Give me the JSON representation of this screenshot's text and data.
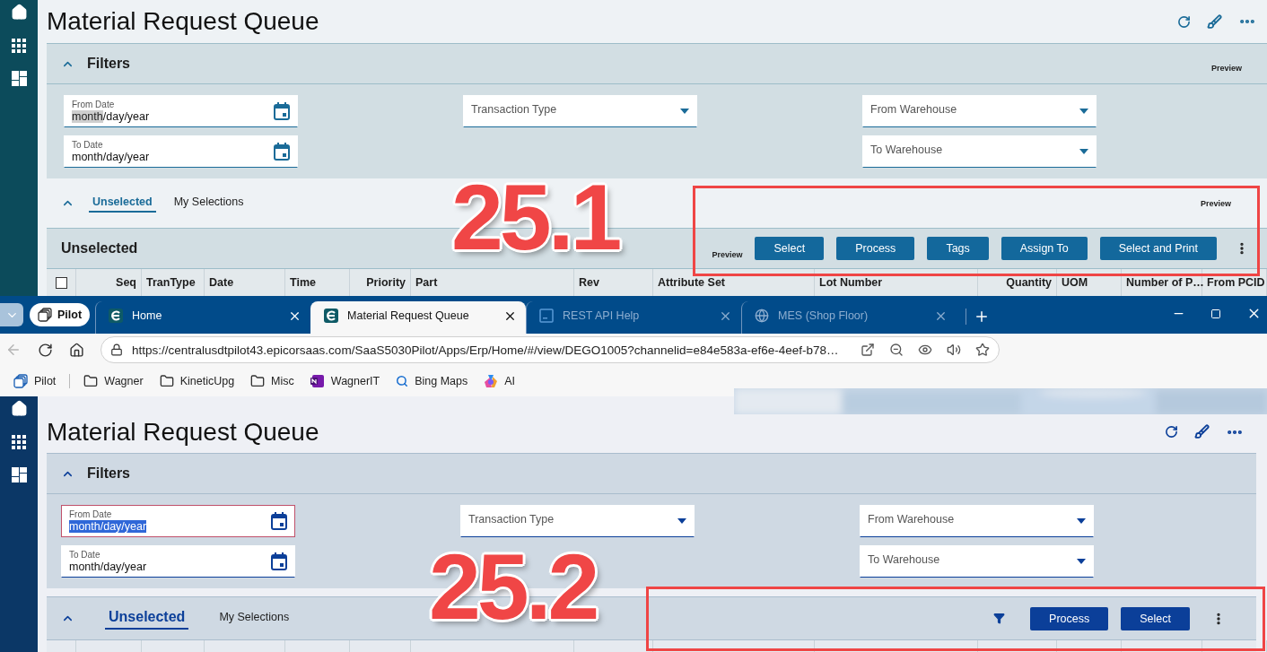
{
  "top_app": {
    "annotation": "25.1",
    "title": "Material Request Queue",
    "filters": {
      "title": "Filters",
      "expanded": true,
      "preview": "Preview",
      "columns": [
        [
          {
            "kind": "date",
            "label": "From Date",
            "focused": false,
            "value_parts": [
              {
                "text": "month",
                "highlighted": true
              },
              {
                "text": "/day/year",
                "highlighted": false
              }
            ]
          },
          {
            "kind": "date",
            "label": "To Date",
            "focused": false,
            "value_parts": [
              {
                "text": "month/day/year",
                "highlighted": false
              }
            ]
          }
        ],
        [
          {
            "kind": "dropdown",
            "label": "Transaction Type",
            "focused": false
          }
        ],
        [
          {
            "kind": "dropdown",
            "label": "From Warehouse",
            "focused": false
          },
          {
            "kind": "dropdown",
            "label": "To Warehouse",
            "focused": false
          }
        ]
      ]
    },
    "tabs_expanded": true,
    "tabs": [
      {
        "label": "Unselected",
        "selected": true
      },
      {
        "label": "My Selections",
        "selected": false
      }
    ],
    "tabs_preview": "Preview",
    "grid": {
      "title": "Unselected",
      "preview": "Preview",
      "buttons": [
        "Select",
        "Process",
        "Tags",
        "Assign To",
        "Select and Print"
      ],
      "select_all_checked": false,
      "columns": [
        {
          "label": "Seq",
          "right_aligned": true
        },
        {
          "label": "TranType",
          "right_aligned": false
        },
        {
          "label": "Date",
          "right_aligned": false
        },
        {
          "label": "Time",
          "right_aligned": false
        },
        {
          "label": "Priority",
          "right_aligned": true
        },
        {
          "label": "Part",
          "right_aligned": false
        },
        {
          "label": "Rev",
          "right_aligned": false
        },
        {
          "label": "Attribute Set",
          "right_aligned": false
        },
        {
          "label": "Lot Number",
          "right_aligned": false
        },
        {
          "label": "Quantity",
          "right_aligned": true
        },
        {
          "label": "UOM",
          "right_aligned": false
        },
        {
          "label": "Number of P…",
          "right_aligned": false
        },
        {
          "label": "From PCID",
          "right_aligned": false
        }
      ]
    }
  },
  "browser": {
    "profile": "Pilot",
    "tabs": [
      {
        "kind": "app",
        "label": "Home",
        "selected": false,
        "dimmed": false
      },
      {
        "kind": "app",
        "label": "Material Request Queue",
        "selected": true,
        "dimmed": false
      },
      {
        "kind": "docs",
        "label": "REST API Help",
        "selected": false,
        "dimmed": true
      },
      {
        "kind": "site",
        "label": "MES (Shop Floor)",
        "selected": false,
        "dimmed": true
      }
    ],
    "back_disabled": true,
    "url": "https://centralusdtpilot43.epicorsaas.com/SaaS5030Pilot/Apps/Erp/Home/#/view/DEGO1005?channelid=e84e583a-ef6e-4eef-b78…",
    "bookmarks": [
      {
        "kind": "profile",
        "label": "Pilot"
      },
      {
        "kind": "folder",
        "label": "Wagner"
      },
      {
        "kind": "folder",
        "label": "KineticUpg"
      },
      {
        "kind": "folder",
        "label": "Misc"
      },
      {
        "kind": "notebook",
        "label": "WagnerIT"
      },
      {
        "kind": "search",
        "label": "Bing Maps"
      },
      {
        "kind": "assistant",
        "label": "AI"
      }
    ]
  },
  "bottom_app": {
    "annotation": "25.2",
    "title": "Material Request Queue",
    "filters": {
      "title": "Filters",
      "expanded": true,
      "columns": [
        [
          {
            "kind": "date",
            "label": "From Date",
            "focused": true,
            "value_parts": [
              {
                "text": "month/day/year",
                "highlighted": true
              }
            ]
          },
          {
            "kind": "date",
            "label": "To Date",
            "focused": false,
            "value_parts": [
              {
                "text": "month/day/year",
                "highlighted": false
              }
            ]
          }
        ],
        [
          {
            "kind": "dropdown",
            "label": "Transaction Type",
            "focused": false
          }
        ],
        [
          {
            "kind": "dropdown",
            "label": "From Warehouse",
            "focused": false
          },
          {
            "kind": "dropdown",
            "label": "To Warehouse",
            "focused": false
          }
        ]
      ]
    },
    "tabs_expanded": true,
    "tabs": [
      {
        "label": "Unselected",
        "selected": true
      },
      {
        "label": "My Selections",
        "selected": false
      }
    ],
    "grid": {
      "buttons": [
        "Process",
        "Select"
      ]
    }
  }
}
